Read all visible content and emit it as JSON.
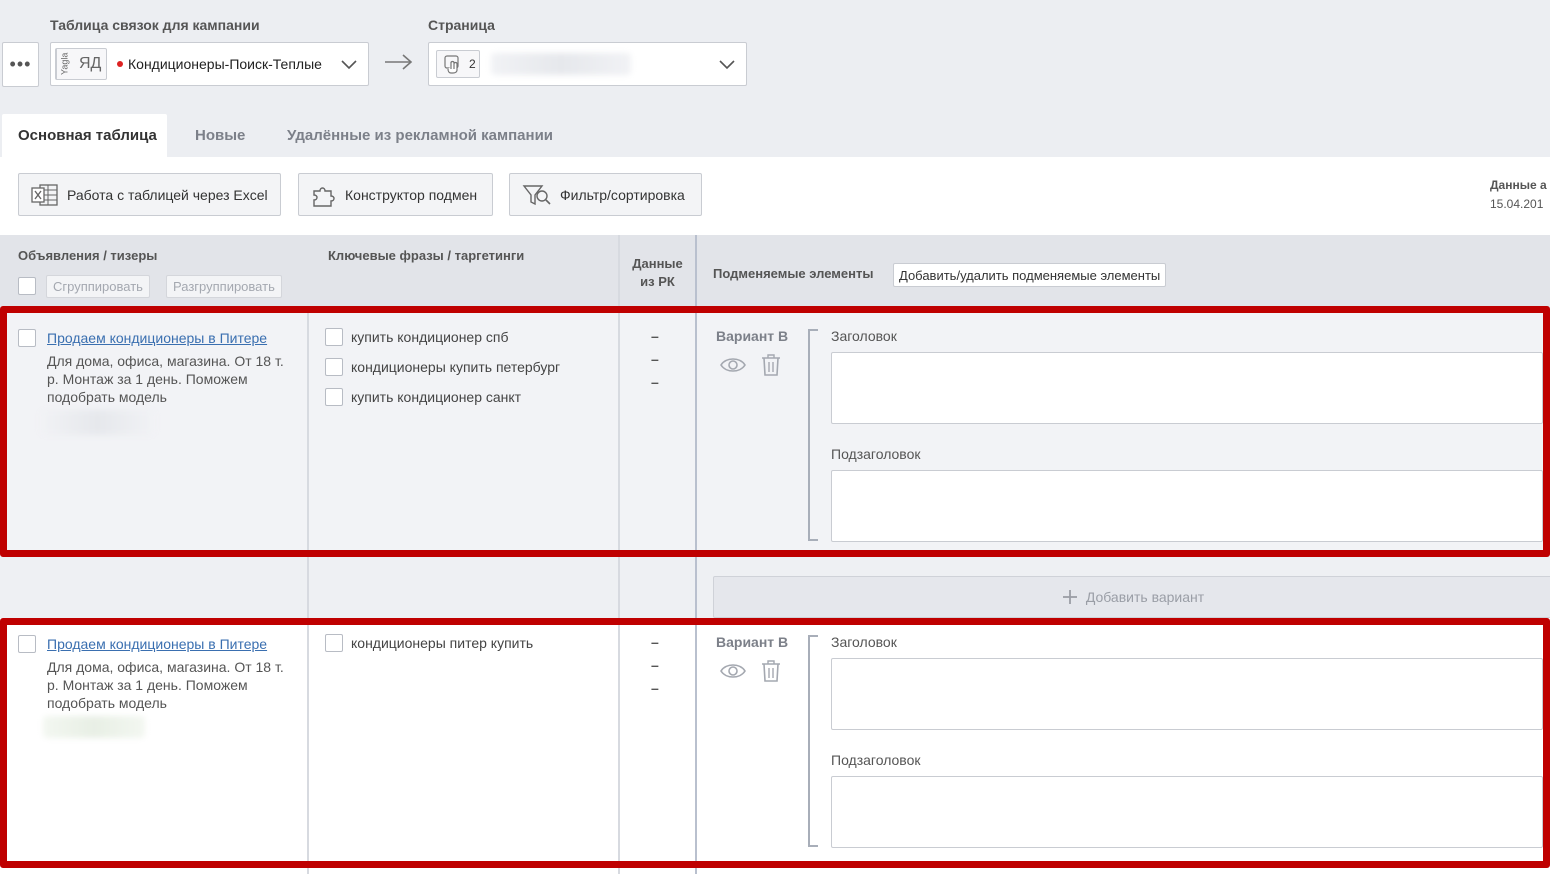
{
  "header": {
    "campaign_label": "Таблица связок для кампании",
    "page_label": "Страница",
    "more_glyph": "•••",
    "yagla_tag": "Yagla",
    "source_tag": "ЯД",
    "campaign_name": "Кондиционеры-Поиск-Теплые",
    "page_number": "2"
  },
  "tabs": [
    {
      "label": "Основная таблица",
      "active": true
    },
    {
      "label": "Новые",
      "active": false
    },
    {
      "label": "Удалённые из рекламной кампании",
      "active": false
    }
  ],
  "toolbar": {
    "excel_label": "Работа с таблицей через Excel",
    "constructor_label": "Конструктор подмен",
    "filter_label": "Фильтр/сортировка",
    "data_label": "Данные а",
    "data_date": "15.04.201"
  },
  "table_header": {
    "ads_title": "Объявления / тизеры",
    "group_btn": "Сгруппировать",
    "ungroup_btn": "Разгруппировать",
    "keywords_title": "Ключевые фразы / таргетинги",
    "rk_title_1": "Данные",
    "rk_title_2": "из РК",
    "replace_title": "Подменяемые элементы",
    "add_remove_btn": "Добавить/удалить подменяемые элементы"
  },
  "rows": [
    {
      "ad_title": "Продаем кондиционеры в Питере",
      "ad_desc": "Для дома, офиса, магазина. От 18 т. р. Монтаж за 1 день. Поможем подобрать модель",
      "keywords": [
        "купить кондиционер спб",
        "кондиционеры купить петербург",
        "купить кондиционер санкт"
      ],
      "rk": [
        "–",
        "–",
        "–"
      ],
      "variant": "Вариант B",
      "field1": "Заголовок",
      "field2": "Подзаголовок"
    },
    {
      "ad_title": "Продаем кондиционеры в Питере",
      "ad_desc": "Для дома, офиса, магазина. От 18 т. р. Монтаж за 1 день. Поможем подобрать модель",
      "keywords": [
        "кондиционеры питер купить"
      ],
      "rk": [
        "–",
        "–",
        "–"
      ],
      "variant": "Вариант B",
      "field1": "Заголовок",
      "field2": "Подзаголовок"
    }
  ],
  "add_variant_label": "Добавить вариант",
  "colors": {
    "accent_red": "#bf0000",
    "link": "#3a6fb0",
    "background": "#eceef2"
  }
}
